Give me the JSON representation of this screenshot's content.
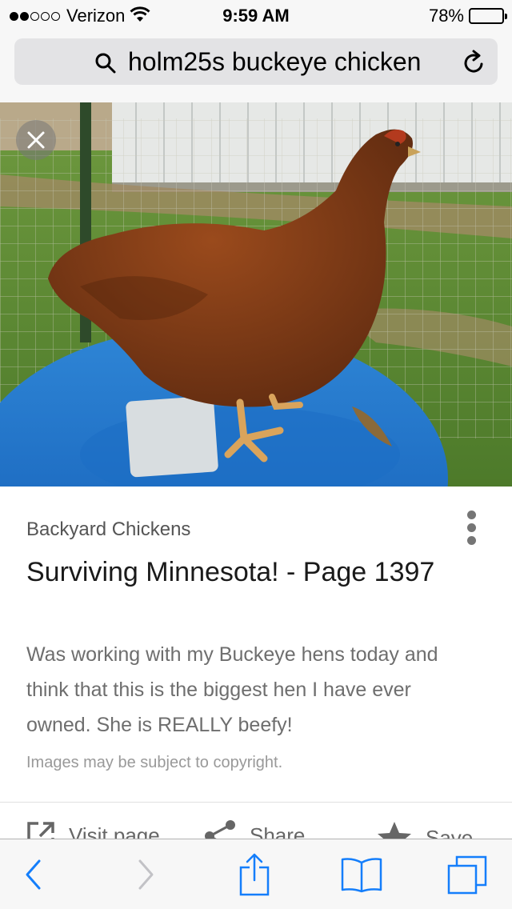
{
  "status_bar": {
    "carrier": "Verizon",
    "signal_bars_filled": 2,
    "signal_bars_total": 5,
    "time": "9:59 AM",
    "battery_percent_label": "78%",
    "battery_level": 0.78
  },
  "address_bar": {
    "query": "holm25s buckeye chicken",
    "search_icon": "search-icon",
    "reload_icon": "reload-icon"
  },
  "image": {
    "close_icon": "close-icon",
    "subject": "photo of a buckeye hen standing on a blue barrel"
  },
  "result": {
    "source": "Backyard Chickens",
    "title": "Surviving Minnesota! - Page 1397",
    "description": "Was working with my Buckeye hens today and think that this is the biggest hen I have ever owned. She is REALLY beefy!",
    "copyright_notice": "Images may be subject to copyright.",
    "more_icon": "more-vertical-icon"
  },
  "actions": {
    "visit_label": "Visit page",
    "share_label": "Share",
    "save_label": "Save"
  },
  "toolbar": {
    "back_icon": "chevron-left-icon",
    "forward_icon": "chevron-right-icon",
    "share_icon": "share-icon",
    "bookmarks_icon": "book-icon",
    "tabs_icon": "tabs-icon"
  },
  "colors": {
    "ios_blue": "#147efb",
    "chrome_bg": "#f7f7f7",
    "address_field": "#e3e3e5"
  }
}
